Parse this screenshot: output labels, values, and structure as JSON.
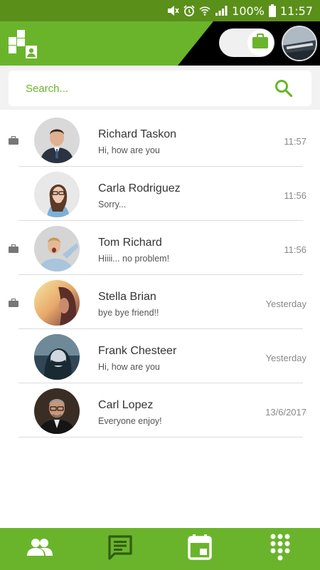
{
  "status_bar": {
    "battery": "100%",
    "time": "11:57"
  },
  "header": {
    "colors": {
      "brand": "#6ab42c",
      "status": "#5a8f1a"
    },
    "toggle_icon": "briefcase-icon"
  },
  "search": {
    "placeholder": "Search..."
  },
  "chats": [
    {
      "name": "Richard Taskon",
      "preview": "Hi, how are you",
      "time": "11:57",
      "work": true
    },
    {
      "name": "Carla Rodriguez",
      "preview": "Sorry...",
      "time": "11:56",
      "work": false
    },
    {
      "name": "Tom Richard",
      "preview": "Hiiii... no problem!",
      "time": "11:56",
      "work": true
    },
    {
      "name": "Stella Brian",
      "preview": "bye bye friend!!",
      "time": "Yesterday",
      "work": true
    },
    {
      "name": "Frank Chesteer",
      "preview": "Hi, how are you",
      "time": "Yesterday",
      "work": false
    },
    {
      "name": "Carl Lopez",
      "preview": "Everyone enjoy!",
      "time": "13/6/2017",
      "work": false
    }
  ],
  "bottom_nav": [
    {
      "icon": "contacts-icon"
    },
    {
      "icon": "chat-icon"
    },
    {
      "icon": "calendar-icon"
    },
    {
      "icon": "dialpad-icon"
    }
  ]
}
